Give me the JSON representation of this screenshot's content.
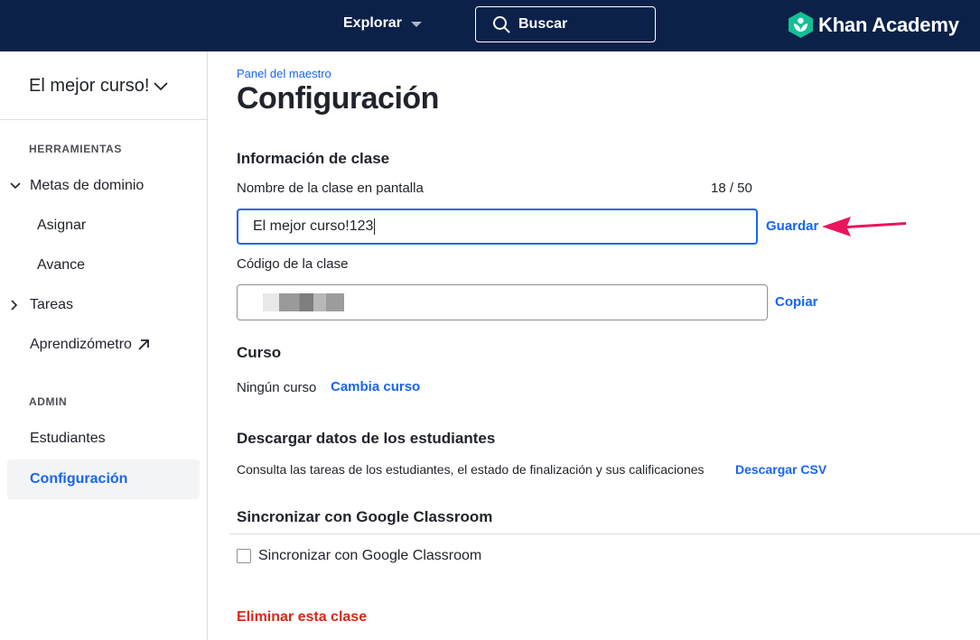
{
  "topbar": {
    "explore_label": "Explorar",
    "search_label": "Buscar",
    "logo_text": "Khan Academy",
    "background": "#0b2149",
    "logo_color": "#14bf96"
  },
  "sidebar": {
    "class_name": "El mejor curso!",
    "tools_label": "HERRAMIENTAS",
    "items": [
      {
        "label": "Metas de dominio",
        "expanded": true
      },
      {
        "label": "Asignar"
      },
      {
        "label": "Avance"
      },
      {
        "label": "Tareas",
        "expanded": false
      },
      {
        "label": "Aprendizómetro",
        "icon": "external-link-icon"
      }
    ],
    "admin_label": "ADMIN",
    "admin_items": [
      {
        "label": "Estudiantes"
      },
      {
        "label": "Configuración",
        "active": true
      }
    ]
  },
  "main": {
    "breadcrumb": "Panel del maestro",
    "title": "Configuración",
    "class_info": {
      "heading": "Información de clase",
      "name_label": "Nombre de la clase en pantalla",
      "char_count": "18 / 50",
      "name_value": "El mejor curso!123",
      "save_label": "Guardar",
      "code_label": "Código de la clase",
      "copy_label": "Copiar"
    },
    "course": {
      "heading": "Curso",
      "value": "Ningún curso",
      "change_label": "Cambia curso"
    },
    "download": {
      "heading": "Descargar datos de los estudiantes",
      "description": "Consulta las tareas de los estudiantes, el estado de finalización y sus calificaciones",
      "link_label": "Descargar CSV"
    },
    "sync": {
      "heading": "Sincronizar con Google Classroom",
      "checkbox_label": "Sincronizar con Google Classroom",
      "checked": false
    },
    "delete_label": "Eliminar esta clase"
  },
  "colors": {
    "accent": "#1865f2",
    "danger": "#d92916",
    "annotation_arrow": "#e8165c"
  }
}
